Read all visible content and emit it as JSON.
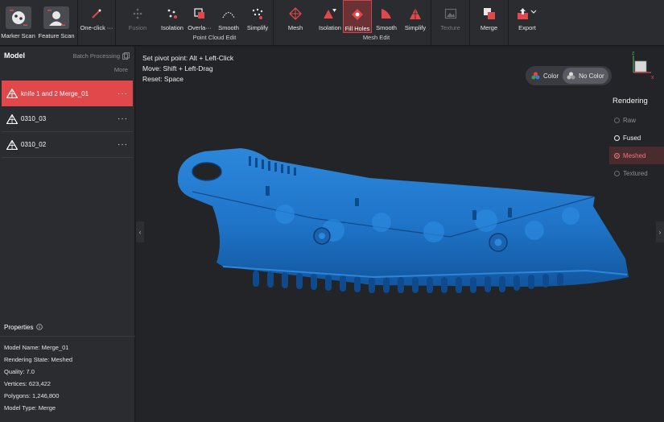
{
  "toolbar": {
    "marker_scan": "Marker Scan",
    "feature_scan": "Feature Scan",
    "one_click": "One-click ···",
    "pc_fusion": "Fusion",
    "pc_isolation": "Isolation",
    "pc_overlap": "Overla···",
    "pc_smooth": "Smooth",
    "pc_simplify": "Simplify",
    "pc_group_label": "Point Cloud Edit",
    "mesh": "Mesh",
    "me_isolation": "Isolation",
    "me_fill_holes": "Fill Holes",
    "me_smooth": "Smooth",
    "me_simplify": "Simplify",
    "me_group_label": "Mesh Edit",
    "texture": "Texture",
    "merge": "Merge",
    "export": "Export"
  },
  "left_panel": {
    "title": "Model",
    "batch": "Batch Processing",
    "more": "More",
    "models": [
      {
        "name": "knife 1 and 2 Merge_01"
      },
      {
        "name": "0310_03"
      },
      {
        "name": "0310_02"
      }
    ],
    "properties_title": "Properties",
    "properties": [
      "Model Name:  Merge_01",
      "Rendering State:  Meshed",
      "Quality:  7.0",
      "Vertices:  623,422",
      "Polygons:  1,246,800",
      "Model Type:  Merge"
    ]
  },
  "viewport": {
    "hint1": "Set pivot point: Alt + Left-Click",
    "hint2": "Move: Shift + Left-Drag",
    "hint3": "Reset: Space",
    "color": "Color",
    "no_color": "No Color",
    "rendering_title": "Rendering",
    "rendering_options": [
      "Raw",
      "Fused",
      "Meshed",
      "Textured"
    ],
    "rendering_selected": "Meshed",
    "model_color": "#1f74c8"
  }
}
